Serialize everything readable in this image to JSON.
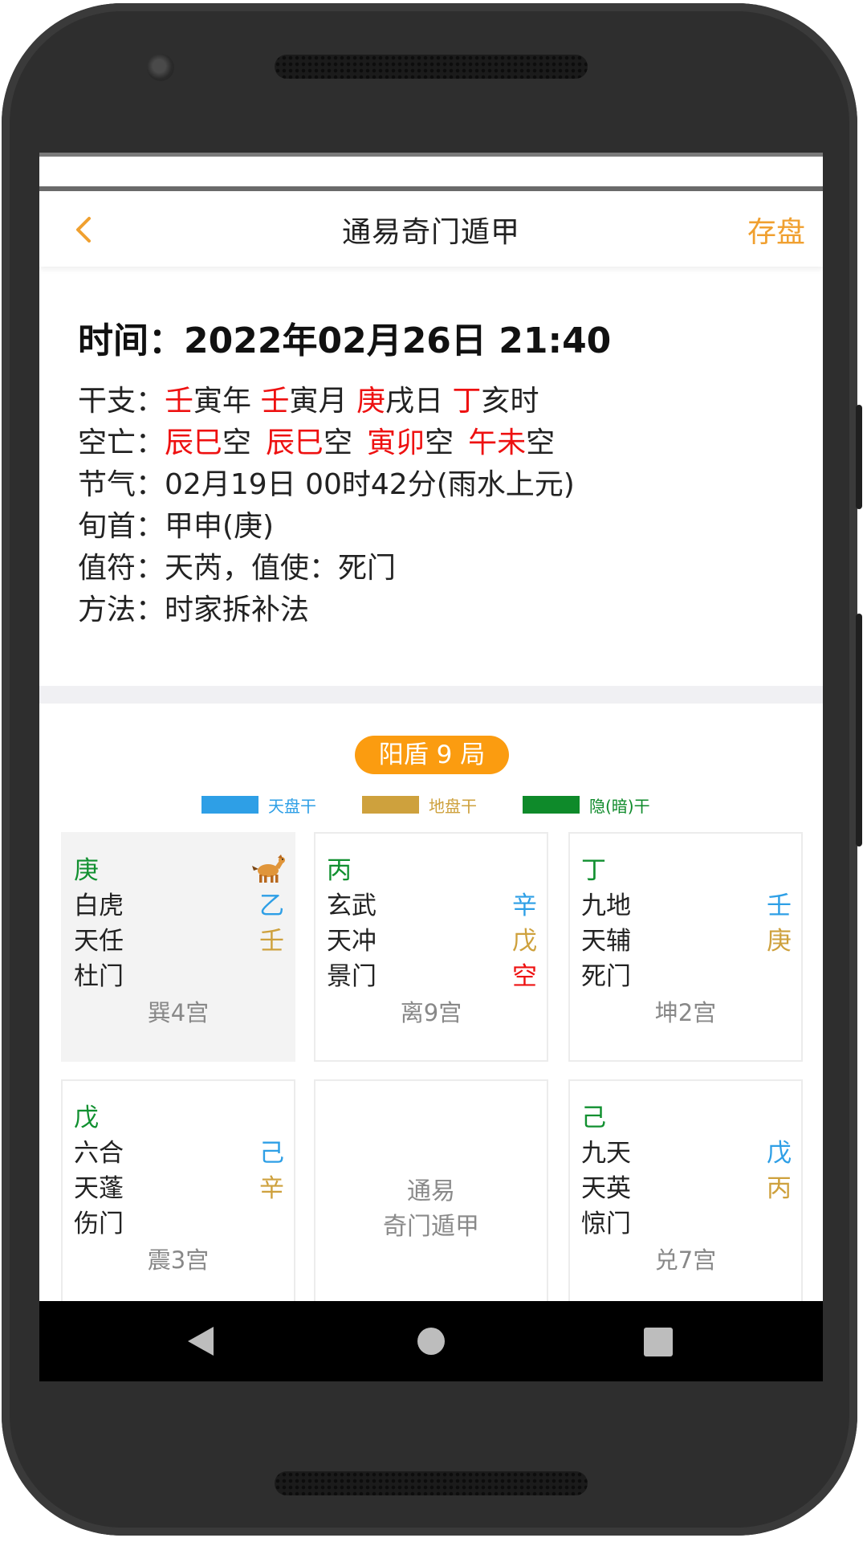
{
  "appbar": {
    "title": "通易奇门遁甲",
    "save_label": "存盘",
    "back_icon": "chevron-left-icon",
    "accent": "#f0a030"
  },
  "info": {
    "time_label": "时间：",
    "time_value": "2022年02月26日 21:40",
    "ganzhi": {
      "label": "干支：",
      "year_stem": "壬",
      "year_rest": "寅年 ",
      "month_stem": "壬",
      "month_rest": "寅月 ",
      "day_stem": "庚",
      "day_rest": "戌日 ",
      "hour_stem": "丁",
      "hour_rest": "亥时"
    },
    "kongwang": {
      "label": "空亡：",
      "year": "辰巳",
      "month": "辰巳",
      "day": "寅卯",
      "hour": "午未",
      "suffix": "空"
    },
    "jieqi": {
      "label": "节气：",
      "value": "02月19日 00时42分(雨水上元)"
    },
    "xunshou": {
      "label": "旬首：",
      "value": "甲申(庚)"
    },
    "zhifu": {
      "label": "值符：",
      "value": "天芮，值使：死门"
    },
    "method": {
      "label": "方法：",
      "value": "时家拆补法"
    }
  },
  "ju_badge": "阳盾 9 局",
  "legend": [
    {
      "label": "天盘干",
      "color": "#2e9fe6"
    },
    {
      "label": "地盘干",
      "color": "#cea13d"
    },
    {
      "label": "隐(暗)干",
      "color": "#0e8a2a"
    }
  ],
  "grid": {
    "c0": {
      "hidden": "庚",
      "god": "白虎",
      "heaven_stem": "乙",
      "star": "天任",
      "earth_stem": "壬",
      "door": "杜门",
      "palace": "巽4宫",
      "icon": "horse-icon"
    },
    "c1": {
      "hidden": "丙",
      "god": "玄武",
      "heaven_stem": "辛",
      "star": "天冲",
      "earth_stem": "戊",
      "door": "景门",
      "mark": "空",
      "palace": "离9宫"
    },
    "c2": {
      "hidden": "丁",
      "god": "九地",
      "heaven_stem": "壬",
      "star": "天辅",
      "earth_stem": "庚",
      "door": "死门",
      "palace": "坤2宫"
    },
    "c3": {
      "hidden": "戊",
      "god": "六合",
      "heaven_stem": "己",
      "star": "天蓬",
      "earth_stem": "辛",
      "door": "伤门",
      "palace": "震3宫"
    },
    "c4": {
      "line1": "通易",
      "line2": "奇门遁甲"
    },
    "c5": {
      "hidden": "己",
      "god": "九天",
      "heaven_stem": "戊",
      "star": "天英",
      "earth_stem": "丙",
      "door": "惊门",
      "palace": "兑7宫"
    }
  },
  "navbar": {
    "back_icon": "triangle-back-icon",
    "home_icon": "circle-home-icon",
    "recents_icon": "square-recents-icon"
  }
}
